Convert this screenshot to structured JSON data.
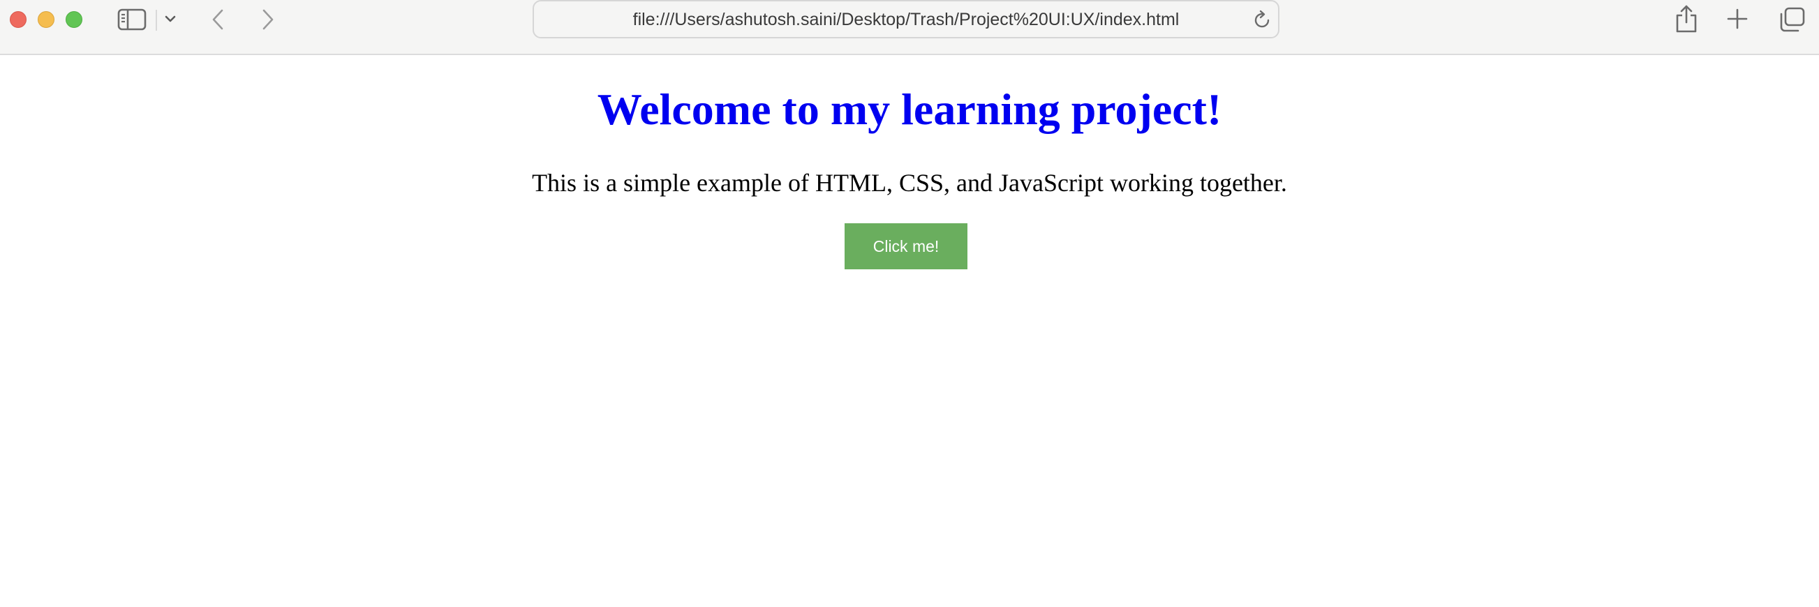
{
  "browser": {
    "address_url": "file:///Users/ashutosh.saini/Desktop/Trash/Project%20UI:UX/index.html",
    "icons": {
      "sidebar": "sidebar-icon",
      "sidebar_menu": "chevron-down-icon",
      "back": "chevron-left-icon",
      "forward": "chevron-right-icon",
      "reload": "reload-icon",
      "share": "share-icon",
      "new_tab": "plus-icon",
      "tab_overview": "tabs-icon"
    }
  },
  "page": {
    "title": "Welcome to my learning project!",
    "text": "This is a simple example of HTML, CSS, and JavaScript working together.",
    "button_label": "Click me!"
  },
  "colors": {
    "title": "#0000f0",
    "button_bg": "#6aae5e",
    "button_text": "#ffffff",
    "toolbar_bg": "#f5f5f4"
  }
}
